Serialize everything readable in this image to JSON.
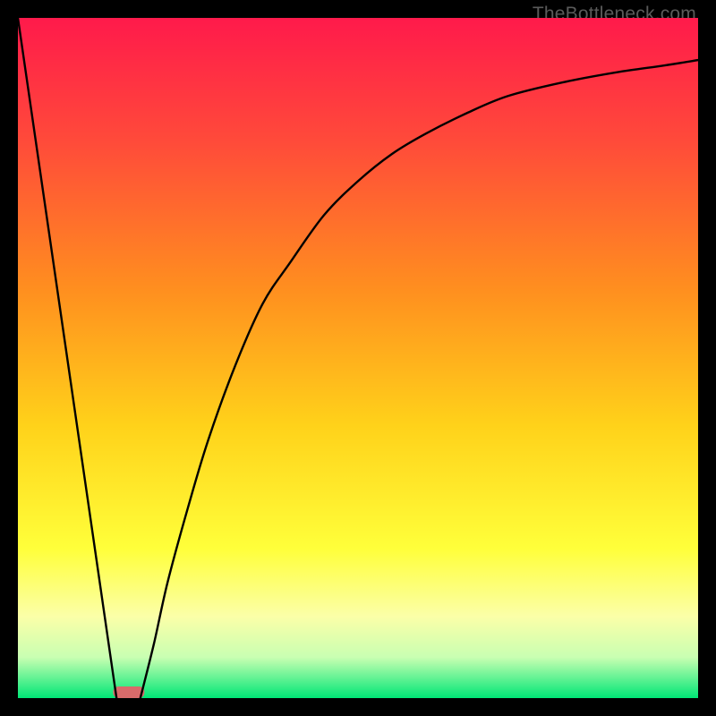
{
  "watermark": "TheBottleneck.com",
  "chart_data": {
    "type": "line",
    "title": "",
    "xlabel": "",
    "ylabel": "",
    "xlim": [
      0,
      100
    ],
    "ylim": [
      0,
      100
    ],
    "grid": false,
    "legend": false,
    "background_gradient": {
      "stops": [
        {
          "offset": 0.0,
          "color": "#ff1a4b"
        },
        {
          "offset": 0.18,
          "color": "#ff4a3a"
        },
        {
          "offset": 0.4,
          "color": "#ff8f1f"
        },
        {
          "offset": 0.6,
          "color": "#ffd21a"
        },
        {
          "offset": 0.78,
          "color": "#ffff3a"
        },
        {
          "offset": 0.88,
          "color": "#fbffa8"
        },
        {
          "offset": 0.94,
          "color": "#c9ffb2"
        },
        {
          "offset": 1.0,
          "color": "#00e676"
        }
      ]
    },
    "series": [
      {
        "name": "left-slope",
        "x": [
          0,
          14.5
        ],
        "y": [
          100,
          0
        ]
      },
      {
        "name": "right-curve",
        "x": [
          18,
          20,
          22,
          25,
          28,
          32,
          36,
          40,
          45,
          50,
          55,
          60,
          66,
          72,
          80,
          88,
          95,
          100
        ],
        "y": [
          0,
          8,
          17,
          28,
          38,
          49,
          58,
          64,
          71,
          76,
          80,
          83,
          86,
          88.5,
          90.5,
          92,
          93,
          93.8
        ]
      }
    ],
    "marker": {
      "name": "valley-marker",
      "x_center": 16.3,
      "width": 4.6,
      "color": "#d96a6a",
      "y": 0
    }
  }
}
